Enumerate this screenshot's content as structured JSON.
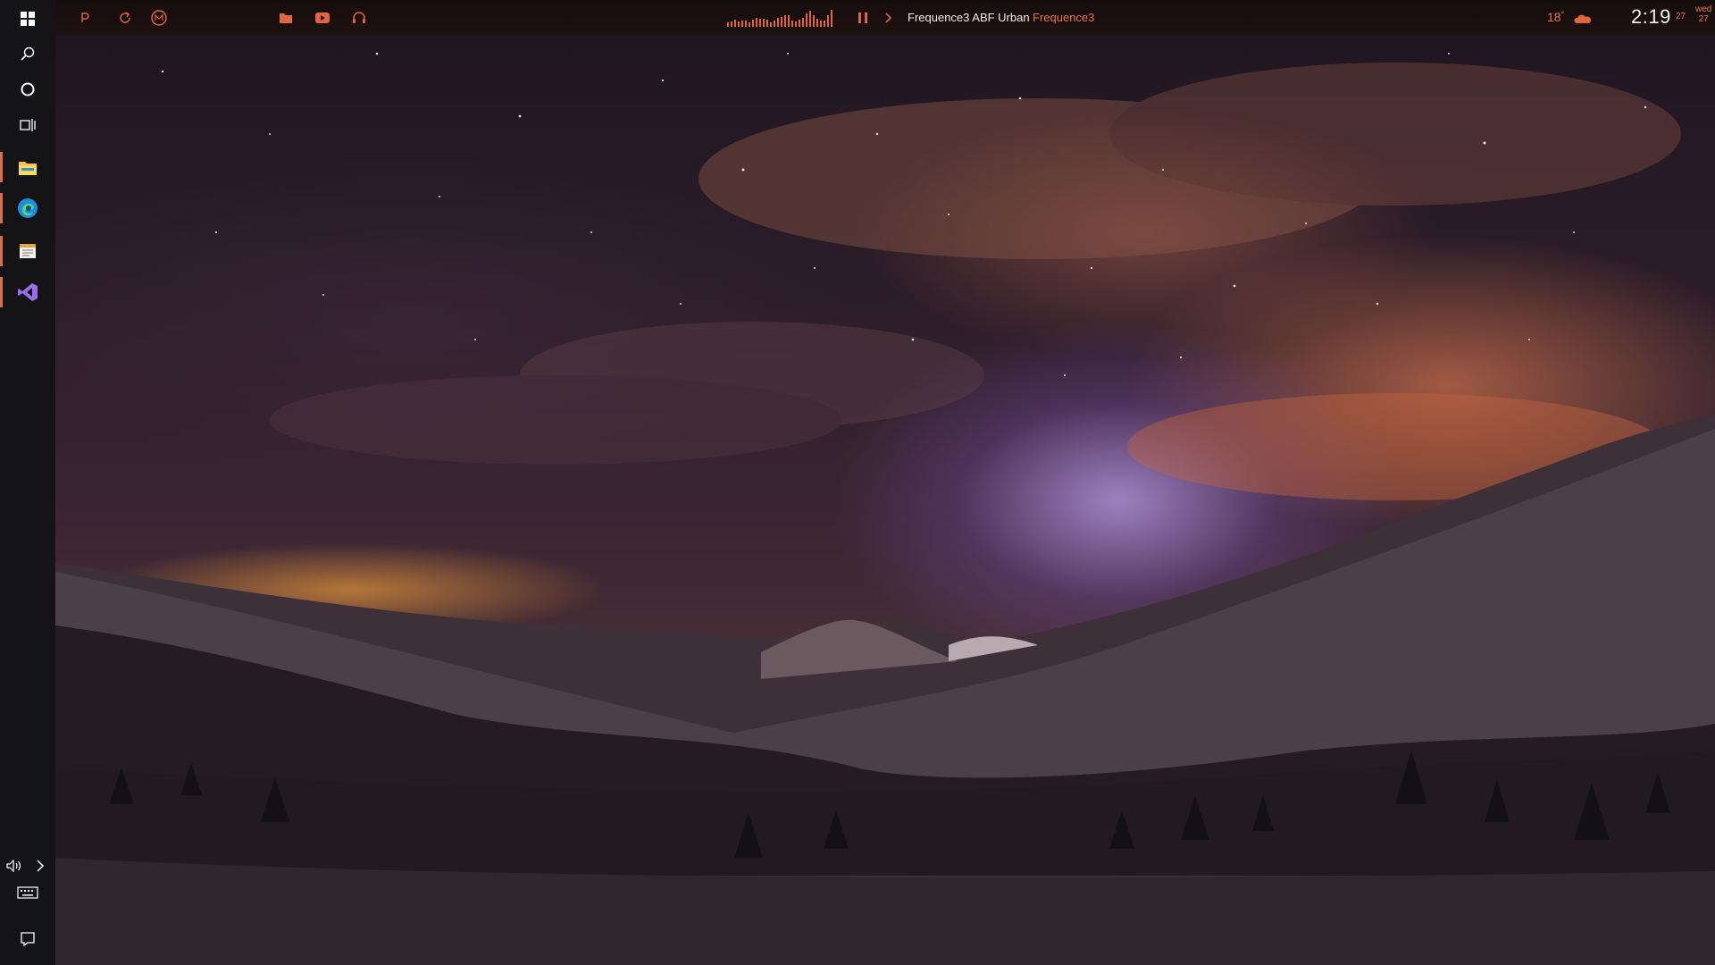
{
  "colors": {
    "accent": "#e0663e",
    "taskbar_bg": "#141417",
    "text_light": "#f1ece8"
  },
  "taskbar": {
    "top_icons": [
      "windows-start-icon",
      "search-icon",
      "cortana-icon",
      "task-view-icon"
    ],
    "pinned_apps": [
      "file-explorer-icon",
      "edge-icon",
      "notepad-icon",
      "visual-studio-icon"
    ],
    "bottom_icons": [
      "volume-icon",
      "expand-chevron-icon",
      "keyboard-icon",
      "notifications-icon"
    ]
  },
  "topbar": {
    "left_icons": [
      "p-icon",
      "refresh-icon",
      "m-icon"
    ],
    "mid_icons": [
      "folder-icon",
      "youtube-icon",
      "headphones-icon"
    ],
    "now_playing": {
      "title": "Frequence3 ABF Urban",
      "artist": "Frequence3"
    },
    "weather": {
      "temp": "18",
      "unit": "°",
      "icon": "cloud-icon"
    },
    "clock": {
      "time": "2:19",
      "date": "27",
      "day": "wed",
      "day_num": "27"
    }
  }
}
